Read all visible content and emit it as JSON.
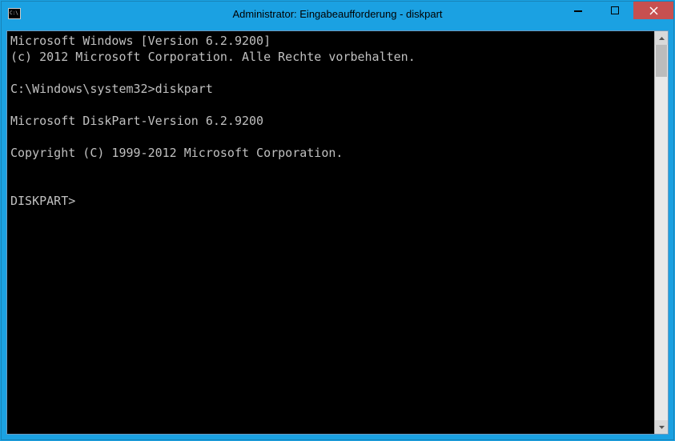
{
  "window": {
    "title": "Administrator: Eingabeaufforderung - diskpart"
  },
  "console": {
    "lines": [
      "Microsoft Windows [Version 6.2.9200]",
      "(c) 2012 Microsoft Corporation. Alle Rechte vorbehalten.",
      "",
      "C:\\Windows\\system32>diskpart",
      "",
      "Microsoft DiskPart-Version 6.2.9200",
      "",
      "Copyright (C) 1999-2012 Microsoft Corporation.",
      "",
      "",
      "DISKPART>"
    ]
  }
}
